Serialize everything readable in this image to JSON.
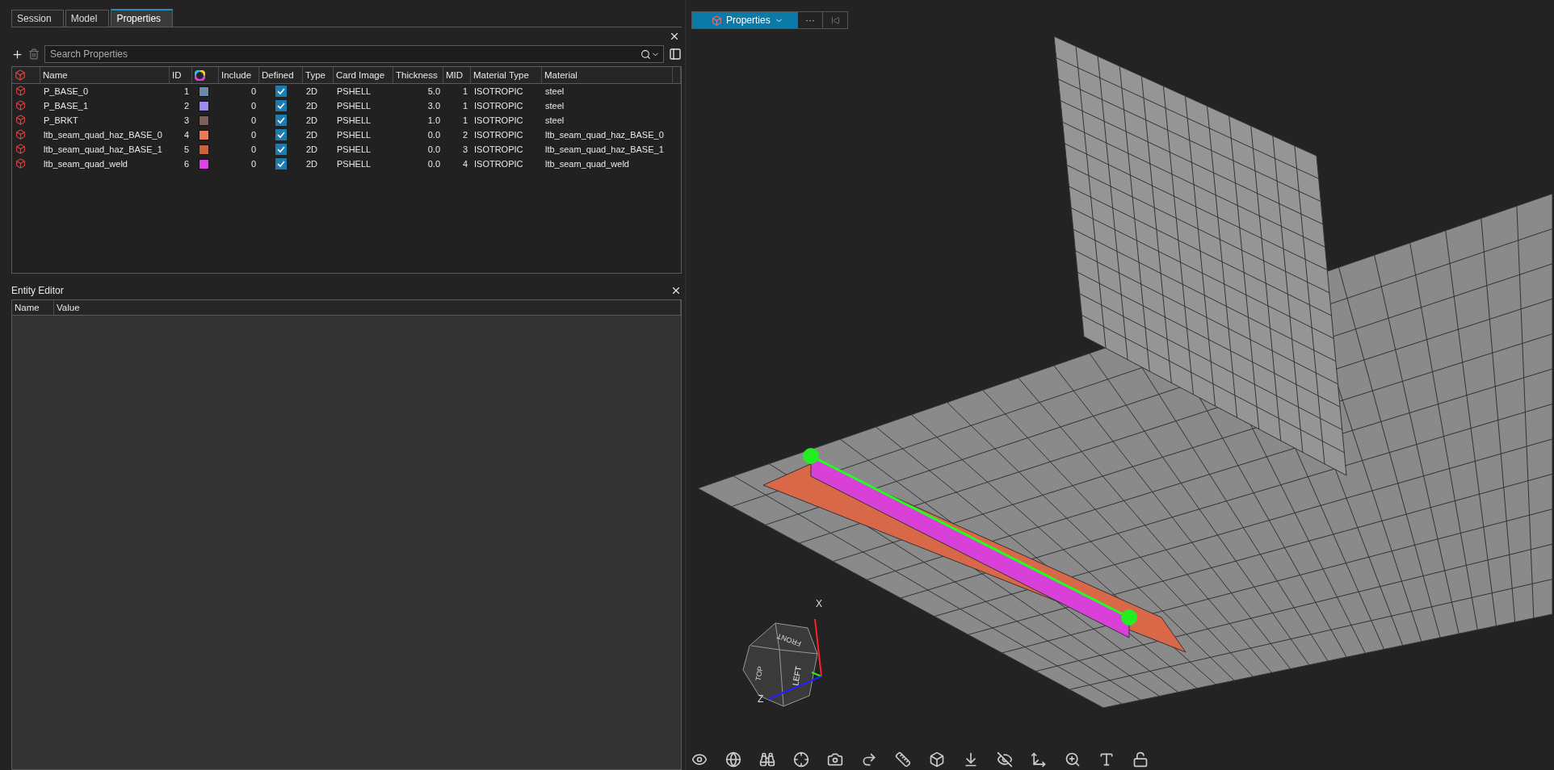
{
  "tabs": [
    {
      "label": "Session",
      "selected": false
    },
    {
      "label": "Model",
      "selected": false
    },
    {
      "label": "Properties",
      "selected": true
    }
  ],
  "properties_panel": {
    "search": {
      "placeholder": "Search Properties"
    },
    "columns": [
      "Name",
      "ID",
      "Include",
      "Defined",
      "Type",
      "Card Image",
      "Thickness",
      "MID",
      "Material Type",
      "Material"
    ],
    "rows": [
      {
        "name": "P_BASE_0",
        "id": "1",
        "color": "#6a8aac",
        "include": "0",
        "defined": true,
        "type": "2D",
        "card_image": "PSHELL",
        "thickness": "5.0",
        "mid": "1",
        "material_type": "ISOTROPIC",
        "material": "steel"
      },
      {
        "name": "P_BASE_1",
        "id": "2",
        "color": "#9a8cf0",
        "include": "0",
        "defined": true,
        "type": "2D",
        "card_image": "PSHELL",
        "thickness": "3.0",
        "mid": "1",
        "material_type": "ISOTROPIC",
        "material": "steel"
      },
      {
        "name": "P_BRKT",
        "id": "3",
        "color": "#7a6058",
        "include": "0",
        "defined": true,
        "type": "2D",
        "card_image": "PSHELL",
        "thickness": "1.0",
        "mid": "1",
        "material_type": "ISOTROPIC",
        "material": "steel"
      },
      {
        "name": "ltb_seam_quad_haz_BASE_0",
        "id": "4",
        "color": "#ec7a52",
        "include": "0",
        "defined": true,
        "type": "2D",
        "card_image": "PSHELL",
        "thickness": "0.0",
        "mid": "2",
        "material_type": "ISOTROPIC",
        "material": "ltb_seam_quad_haz_BASE_0"
      },
      {
        "name": "ltb_seam_quad_haz_BASE_1",
        "id": "5",
        "color": "#d0603c",
        "include": "0",
        "defined": true,
        "type": "2D",
        "card_image": "PSHELL",
        "thickness": "0.0",
        "mid": "3",
        "material_type": "ISOTROPIC",
        "material": "ltb_seam_quad_haz_BASE_1"
      },
      {
        "name": "ltb_seam_quad_weld",
        "id": "6",
        "color": "#e040e8",
        "include": "0",
        "defined": true,
        "type": "2D",
        "card_image": "PSHELL",
        "thickness": "0.0",
        "mid": "4",
        "material_type": "ISOTROPIC",
        "material": "ltb_seam_quad_weld"
      }
    ]
  },
  "entity_editor": {
    "title": "Entity Editor",
    "columns": [
      "Name",
      "Value"
    ]
  },
  "viewport": {
    "context_button": "Properties",
    "more_button": "···",
    "cube_labels": [
      "FRONT",
      "TOP",
      "LEFT"
    ],
    "axes": [
      "X",
      "Z"
    ]
  }
}
